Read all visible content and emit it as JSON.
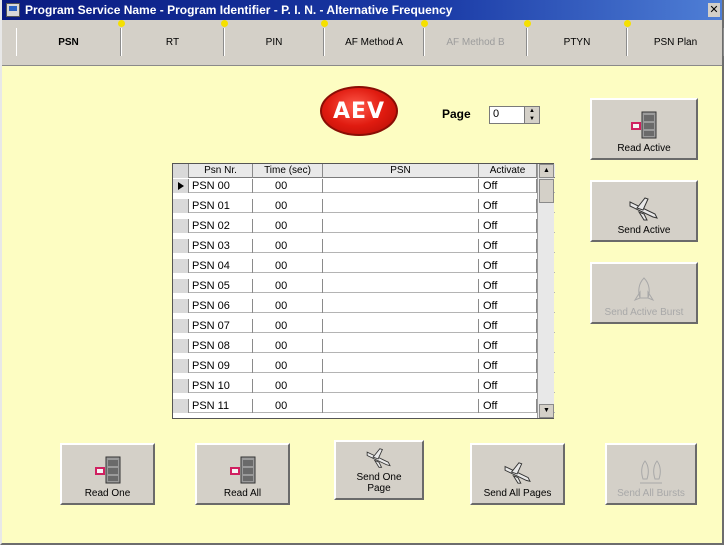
{
  "window": {
    "title": "Program Service Name - Program Identifier - P. I. N. - Alternative Frequency",
    "close_label": "✕"
  },
  "tabs": [
    {
      "label": "PSN",
      "state": "active"
    },
    {
      "label": "RT",
      "state": "normal"
    },
    {
      "label": "PIN",
      "state": "normal"
    },
    {
      "label": "AF Method A",
      "state": "normal"
    },
    {
      "label": "AF Method B",
      "state": "disabled"
    },
    {
      "label": "PTYN",
      "state": "normal"
    },
    {
      "label": "PSN Plan",
      "state": "normal"
    }
  ],
  "logo": {
    "text": "AEV",
    "color": "#e01b10"
  },
  "page": {
    "label": "Page",
    "value": "0"
  },
  "grid": {
    "columns": [
      "Psn Nr.",
      "Time (sec)",
      "PSN",
      "Activate"
    ],
    "rows": [
      {
        "nr": "PSN 00",
        "time": "00",
        "psn": "",
        "activate": "Off"
      },
      {
        "nr": "PSN 01",
        "time": "00",
        "psn": "",
        "activate": "Off"
      },
      {
        "nr": "PSN 02",
        "time": "00",
        "psn": "",
        "activate": "Off"
      },
      {
        "nr": "PSN 03",
        "time": "00",
        "psn": "",
        "activate": "Off"
      },
      {
        "nr": "PSN 04",
        "time": "00",
        "psn": "",
        "activate": "Off"
      },
      {
        "nr": "PSN 05",
        "time": "00",
        "psn": "",
        "activate": "Off"
      },
      {
        "nr": "PSN 06",
        "time": "00",
        "psn": "",
        "activate": "Off"
      },
      {
        "nr": "PSN 07",
        "time": "00",
        "psn": "",
        "activate": "Off"
      },
      {
        "nr": "PSN 08",
        "time": "00",
        "psn": "",
        "activate": "Off"
      },
      {
        "nr": "PSN 09",
        "time": "00",
        "psn": "",
        "activate": "Off"
      },
      {
        "nr": "PSN 10",
        "time": "00",
        "psn": "",
        "activate": "Off"
      },
      {
        "nr": "PSN 11",
        "time": "00",
        "psn": "",
        "activate": "Off"
      }
    ]
  },
  "buttons": {
    "read_active": "Read Active",
    "send_active": "Send Active",
    "send_active_burst": "Send Active Burst",
    "read_one": "Read One",
    "read_all": "Read All",
    "send_one_page": "Send One Page",
    "send_all_pages": "Send All Pages",
    "send_all_bursts": "Send All Bursts"
  },
  "colors": {
    "background": "#fdfdc2",
    "titlebar": "#0a1b80",
    "button_face": "#d4d0c8",
    "disabled_text": "#a8a8a8"
  }
}
